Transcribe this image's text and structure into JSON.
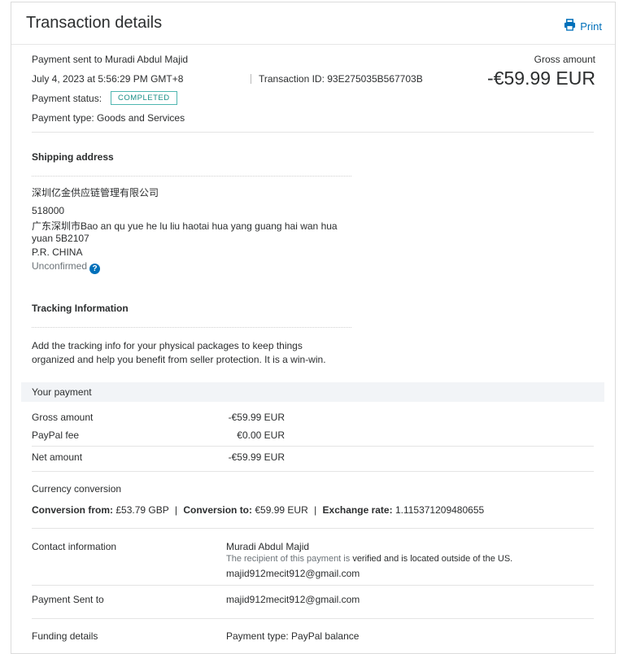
{
  "header": {
    "title": "Transaction details",
    "print_label": "Print"
  },
  "summary": {
    "sent_to": "Payment sent to Muradi Abdul Majid",
    "datetime": "July 4, 2023 at 5:56:29 PM GMT+8",
    "transaction_id": "Transaction ID: 93E275035B567703B",
    "status_label": "Payment status:",
    "status_badge": "COMPLETED",
    "payment_type": "Payment type: Goods and Services",
    "gross_label": "Gross amount",
    "gross_amount": "-€59.99 EUR"
  },
  "shipping": {
    "heading": "Shipping address",
    "company": "深圳亿金供应链管理有限公司",
    "postcode": "518000",
    "line1": "广东深圳市Bao an qu yue he lu liu haotai hua yang guang hai wan hua",
    "line2": "yuan 5B2107",
    "country": "P.R. CHINA",
    "confirmation": "Unconfirmed",
    "help_glyph": "?"
  },
  "tracking": {
    "heading": "Tracking Information",
    "text1": "Add the tracking info for your physical packages to keep things",
    "text2": "organized and help you benefit from seller protection. It is a win-win."
  },
  "payment": {
    "heading": "Your payment",
    "rows": [
      {
        "label": "Gross amount",
        "value": "-€59.99 EUR"
      },
      {
        "label": "PayPal fee",
        "value": "€0.00 EUR"
      },
      {
        "label": "Net amount",
        "value": "-€59.99 EUR"
      }
    ]
  },
  "conversion": {
    "heading": "Currency conversion",
    "from_label": "Conversion from:",
    "from_value": "£53.79 GBP",
    "to_label": "Conversion to:",
    "to_value": "€59.99 EUR",
    "rate_label": "Exchange rate:",
    "rate_value": "1.115371209480655",
    "divider": "|"
  },
  "contact": {
    "label": "Contact information",
    "name": "Muradi Abdul Majid",
    "note_prefix": "The recipient of this payment is",
    "note_bold": "verified and is located outside of the US",
    "note_suffix": ".",
    "email": "majid912mecit912@gmail.com"
  },
  "sent_to": {
    "label": "Payment Sent to",
    "email": "majid912mecit912@gmail.com"
  },
  "funding": {
    "label": "Funding details",
    "value": "Payment type: PayPal balance"
  },
  "colors": {
    "link": "#0070ba",
    "badge": "#1b8f87",
    "band": "#f2f4f7"
  },
  "icons": {
    "print": "printer-icon",
    "help": "question-circle-icon"
  }
}
